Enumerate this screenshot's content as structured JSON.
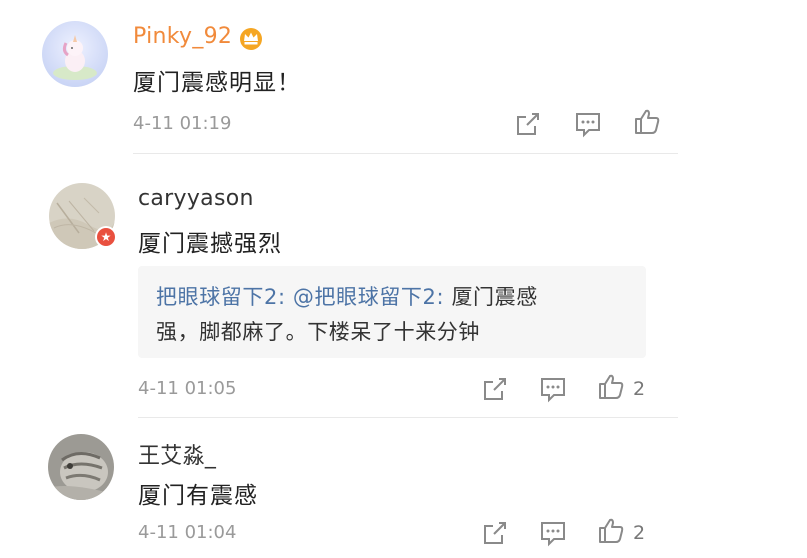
{
  "comments": [
    {
      "username": "Pinky_92",
      "username_color": "#f18a3b",
      "text": "厦门震感明显！",
      "time": "4-11 01:19",
      "like_count": ""
    },
    {
      "username": "caryyason",
      "username_color": "#333333",
      "text": "厦门震撼强烈",
      "quote": {
        "author": "把眼球留下2:",
        "mention": "@把眼球留下2:",
        "text_line1": " 厦门震感",
        "text_line2": "强，脚都麻了。下楼呆了十来分钟"
      },
      "time": "4-11 01:05",
      "like_count": "2"
    },
    {
      "username": "王艾淼_",
      "username_color": "#333333",
      "text": "厦门有震感",
      "time": "4-11 01:04",
      "like_count": "2"
    }
  ],
  "colors": {
    "link": "#4d74a6",
    "vip_crown": "#f5a623",
    "badge": "#e9503f"
  },
  "icons": [
    "share-icon",
    "comment-icon",
    "like-icon",
    "vip-crown-icon",
    "verified-badge-icon"
  ]
}
